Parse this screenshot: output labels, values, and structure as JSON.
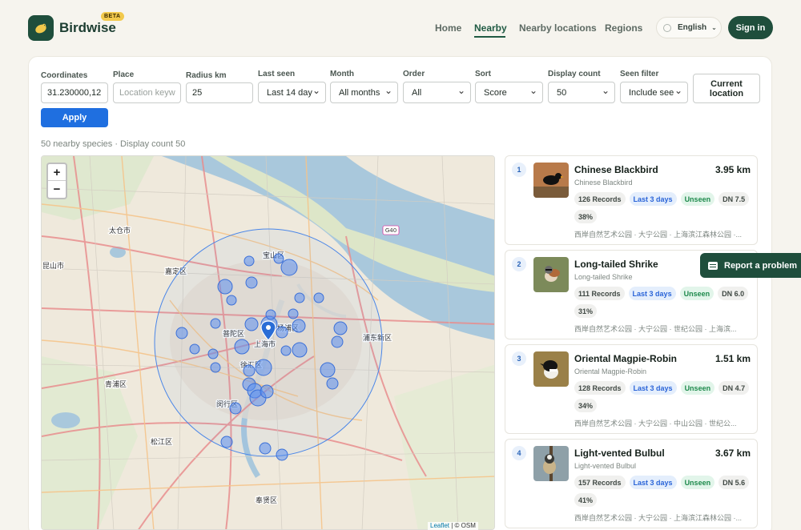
{
  "brand": {
    "name": "Birdwise",
    "badge": "BETA"
  },
  "nav": {
    "home": "Home",
    "nearby": "Nearby",
    "nearby_locations": "Nearby locations",
    "regions": "Regions"
  },
  "language": "English",
  "signin": "Sign in",
  "filters": {
    "coordinates": {
      "label": "Coordinates",
      "value": "31.230000,12"
    },
    "place": {
      "label": "Place",
      "placeholder": "Location keyw"
    },
    "radius": {
      "label": "Radius km",
      "value": "25"
    },
    "last_seen": {
      "label": "Last seen",
      "value": "Last 14 day"
    },
    "month": {
      "label": "Month",
      "value": "All months"
    },
    "order": {
      "label": "Order",
      "value": "All"
    },
    "sort": {
      "label": "Sort",
      "value": "Score"
    },
    "display_count": {
      "label": "Display count",
      "value": "50"
    },
    "seen_filter": {
      "label": "Seen filter",
      "value": "Include see"
    },
    "current_location": "Current location",
    "apply": "Apply"
  },
  "summary": "50 nearby species · Display count 50",
  "map": {
    "zoom_in": "+",
    "zoom_out": "−",
    "attribution_leaflet": "Leaflet",
    "attribution_osm": " | © OSM",
    "labels": {
      "taicang": "太仓市",
      "baoshan": "宝山区",
      "kunshan": "昆山市",
      "jiading": "嘉定区",
      "putuo": "普陀区",
      "yangpu": "杨浦区",
      "shanghai": "上海市",
      "xuhui": "徐汇区",
      "qingpu": "青浦区",
      "minhang": "闵行区",
      "songjiang": "松江区",
      "fengxian": "奉贤区",
      "pudong": "浦东新区",
      "highway": "G40"
    }
  },
  "results": [
    {
      "rank": "1",
      "name": "Chinese Blackbird",
      "sub": "Chinese Blackbird",
      "distance": "3.95 km",
      "records": "126 Records",
      "last": "Last 3 days",
      "seen": "Unseen",
      "dn": "DN 7.5",
      "pct": "38%",
      "locations": "西岸自然艺术公园 · 大宁公园 · 上海滨江森林公园 ·..."
    },
    {
      "rank": "2",
      "name": "Long-tailed Shrike",
      "sub": "Long-tailed Shrike",
      "distance": "",
      "records": "111 Records",
      "last": "Last 3 days",
      "seen": "Unseen",
      "dn": "DN 6.0",
      "pct": "31%",
      "locations": "西岸自然艺术公园 · 大宁公园 · 世纪公园 · 上海滨..."
    },
    {
      "rank": "3",
      "name": "Oriental Magpie-Robin",
      "sub": "Oriental Magpie-Robin",
      "distance": "1.51 km",
      "records": "128 Records",
      "last": "Last 3 days",
      "seen": "Unseen",
      "dn": "DN 4.7",
      "pct": "34%",
      "locations": "西岸自然艺术公园 · 大宁公园 · 中山公园 · 世纪公..."
    },
    {
      "rank": "4",
      "name": "Light-vented Bulbul",
      "sub": "Light-vented Bulbul",
      "distance": "3.67 km",
      "records": "157 Records",
      "last": "Last 3 days",
      "seen": "Unseen",
      "dn": "DN 5.6",
      "pct": "41%",
      "locations": "西岸自然艺术公园 · 大宁公园 · 上海滨江森林公园 ·..."
    }
  ],
  "report_problem": "Report a problem",
  "colors": {
    "brand": "#1f4e3c",
    "primary": "#1f6fe0",
    "unseen": "#1e8a4c"
  }
}
